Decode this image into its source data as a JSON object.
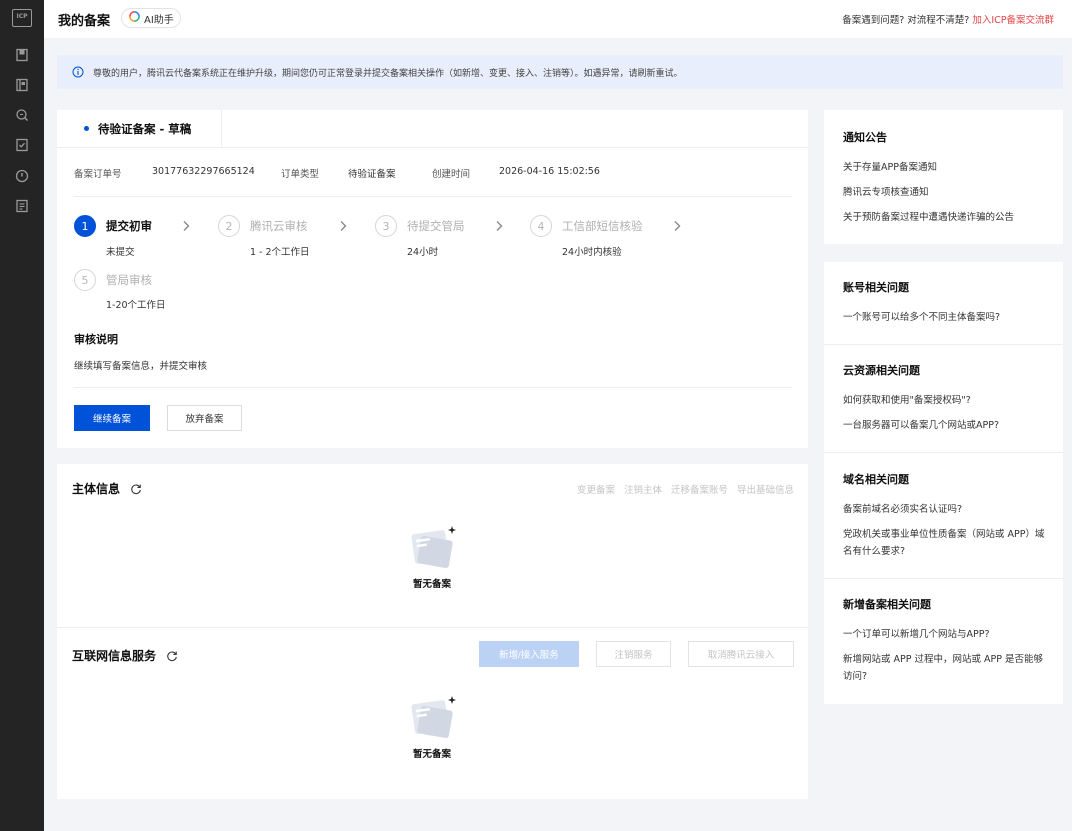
{
  "sidebar": {
    "logo": "ICP",
    "icons": [
      "bookmark-icon",
      "book-icon",
      "search-doc-icon",
      "check-icon",
      "clock-icon",
      "document-icon"
    ]
  },
  "header": {
    "title": "我的备案",
    "ai_label": "AI助手",
    "help_text": "备案遇到问题? 对流程不清楚?",
    "help_link": "加入ICP备案交流群"
  },
  "notice": {
    "text": "尊敬的用户，腾讯云代备案系统正在维护升级，期间您仍可正常登录并提交备案相关操作（如新增、变更、接入、注销等）。如遇异常，请刷新重试。"
  },
  "status_card": {
    "tab_label": "待验证备案 - 草稿",
    "meta": {
      "order_no_label": "备案订单号",
      "order_no": "30177632297665124",
      "order_type_label": "订单类型",
      "order_type": "待验证备案",
      "created_label": "创建时间",
      "created_time": "2026-04-16 15:02:56"
    },
    "steps": [
      {
        "num": "1",
        "label": "提交初审",
        "sub": "未提交"
      },
      {
        "num": "2",
        "label": "腾讯云审核",
        "sub": "1 - 2个工作日"
      },
      {
        "num": "3",
        "label": "待提交管局",
        "sub": "24小时"
      },
      {
        "num": "4",
        "label": "工信部短信核验",
        "sub": "24小时内核验"
      },
      {
        "num": "5",
        "label": "管局审核",
        "sub": "1-20个工作日"
      }
    ],
    "review_title": "审核说明",
    "review_text": "继续填写备案信息，并提交审核",
    "continue_btn": "继续备案",
    "abandon_btn": "放弃备案"
  },
  "subject_info": {
    "title": "主体信息",
    "links": [
      "变更备案",
      "注销主体",
      "迁移备案账号",
      "导出基础信息"
    ],
    "empty_text": "暂无备案"
  },
  "internet_service": {
    "title": "互联网信息服务",
    "btn_add": "新增/接入服务",
    "btn_cancel": "注销服务",
    "btn_cancel_access": "取消腾讯云接入",
    "empty_text": "暂无备案"
  },
  "right_panel": {
    "notice": {
      "title": "通知公告",
      "items": [
        "关于存量APP备案通知",
        "腾讯云专项核查通知",
        "关于预防备案过程中遭遇快递诈骗的公告"
      ]
    },
    "account": {
      "title": "账号相关问题",
      "items": [
        "一个账号可以给多个不同主体备案吗?"
      ]
    },
    "cloud": {
      "title": "云资源相关问题",
      "items": [
        "如何获取和使用\"备案授权码\"?",
        "一台服务器可以备案几个网站或APP?"
      ]
    },
    "domain": {
      "title": "域名相关问题",
      "items": [
        "备案前域名必须实名认证吗?",
        "党政机关或事业单位性质备案（网站或 APP）域名有什么要求?"
      ]
    },
    "new_filing": {
      "title": "新增备案相关问题",
      "items": [
        "一个订单可以新增几个网站与APP?",
        "新增网站或 APP 过程中，网站或 APP 是否能够访问?"
      ]
    }
  }
}
